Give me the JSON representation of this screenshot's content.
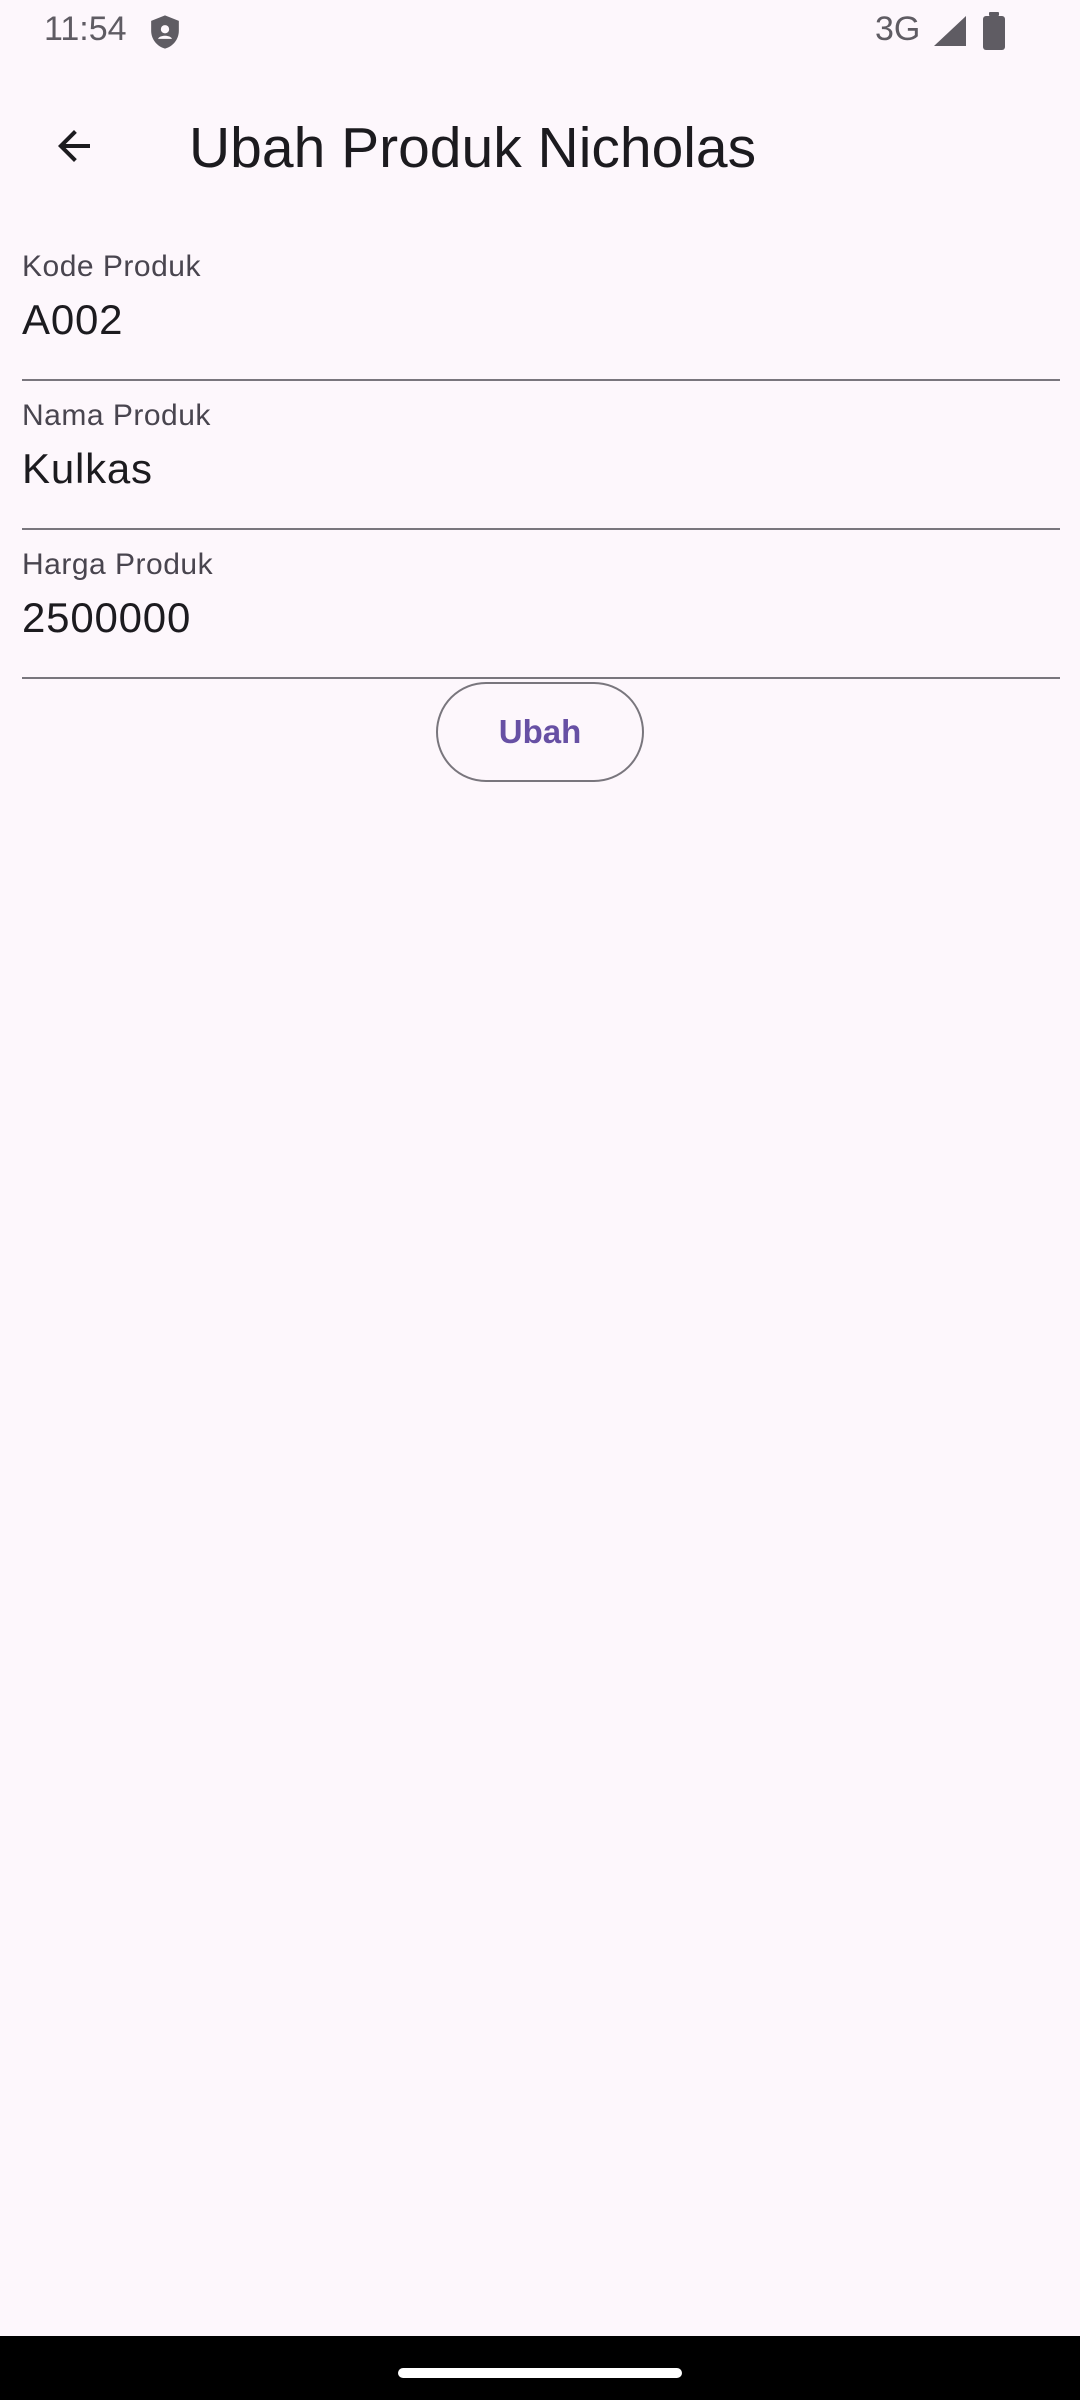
{
  "status_bar": {
    "time": "11:54",
    "network": "3G",
    "icons": [
      "shield-icon",
      "signal-icon",
      "battery-icon"
    ]
  },
  "app_bar": {
    "title": "Ubah Produk Nicholas",
    "back_icon": "arrow-back-icon"
  },
  "form": {
    "fields": [
      {
        "label": "Kode Produk",
        "value": "A002"
      },
      {
        "label": "Nama Produk",
        "value": "Kulkas"
      },
      {
        "label": "Harga Produk",
        "value": "2500000"
      }
    ],
    "submit_label": "Ubah"
  },
  "colors": {
    "background": "#fdf7fc",
    "primary": "#6750a4",
    "outline": "#79767d",
    "on_surface": "#1c1b1f"
  }
}
